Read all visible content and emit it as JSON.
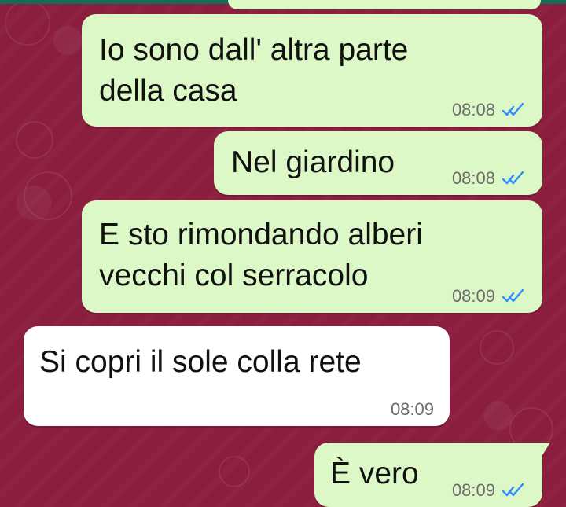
{
  "chat": {
    "messages": [
      {
        "text": "Io sono dall' altra parte\ndella casa",
        "time": "08:08",
        "direction": "outgoing",
        "status_icon": "double-check-icon"
      },
      {
        "text": "Nel giardino",
        "time": "08:08",
        "direction": "outgoing",
        "status_icon": "double-check-icon"
      },
      {
        "text": "E sto rimondando alberi\nvecchi col serracolo",
        "time": "08:09",
        "direction": "outgoing",
        "status_icon": "double-check-icon"
      },
      {
        "text": "Si copri il sole colla rete",
        "time": "08:09",
        "direction": "incoming"
      },
      {
        "text": "È vero",
        "time": "08:09",
        "direction": "outgoing",
        "status_icon": "double-check-icon"
      }
    ]
  },
  "colors": {
    "background": "#8b1e3f",
    "outgoing_bubble": "#ddf8c7",
    "incoming_bubble": "#ffffff",
    "check_blue": "#2f8cff",
    "time_gray": "#6c6c6c"
  }
}
